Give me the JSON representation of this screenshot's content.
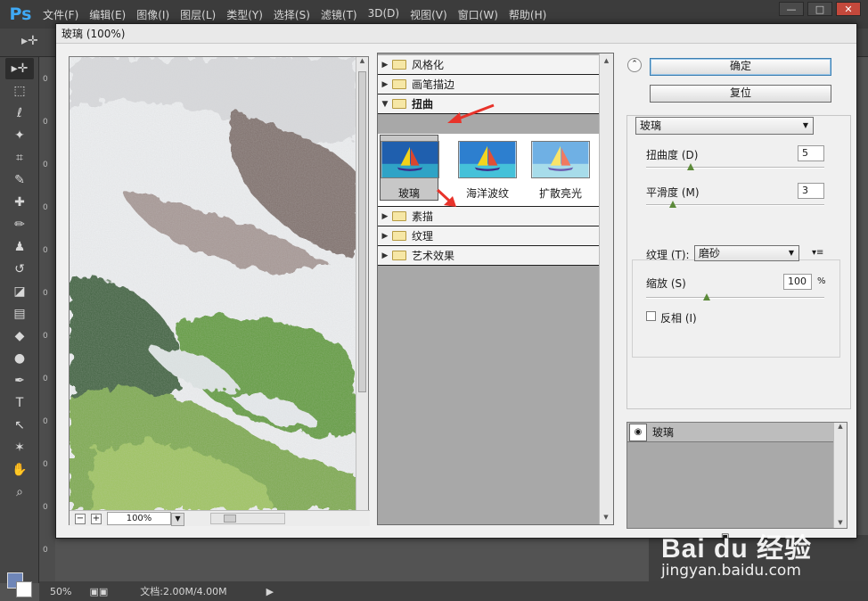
{
  "app": {
    "logo": "Ps",
    "menus": [
      "文件(F)",
      "编辑(E)",
      "图像(I)",
      "图层(L)",
      "类型(Y)",
      "选择(S)",
      "滤镜(T)",
      "3D(D)",
      "视图(V)",
      "窗口(W)",
      "帮助(H)"
    ],
    "window_controls": {
      "minimize": "—",
      "maximize": "□",
      "close": "✕"
    }
  },
  "toolbar": {
    "tools": [
      "move-icon",
      "marquee-icon",
      "lasso-icon",
      "magic-wand-icon",
      "crop-icon",
      "eyedropper-icon",
      "healing-icon",
      "brush-icon",
      "stamp-icon",
      "history-brush-icon",
      "eraser-icon",
      "gradient-icon",
      "blur-icon",
      "dodge-icon",
      "pen-icon",
      "type-icon",
      "path-select-icon",
      "shape-icon",
      "hand-icon",
      "zoom-icon"
    ],
    "glyphs": [
      "▸✛",
      "⬚",
      "ℓ",
      "✦",
      "⌗",
      "✎",
      "✚",
      "✏",
      "♟",
      "↺",
      "◪",
      "▤",
      "◆",
      "●",
      "✒",
      "T",
      "↖",
      "✶",
      "✋",
      "⌕"
    ],
    "ruler_numbers": [
      "0",
      "0",
      "0",
      "0",
      "0",
      "0",
      "0",
      "0",
      "0",
      "0",
      "0",
      "0"
    ]
  },
  "statusbar": {
    "zoom": "50%",
    "doc_info": "文档:2.00M/4.00M"
  },
  "watermark": {
    "logo": "Bai du 经验",
    "url": "jingyan.baidu.com"
  },
  "dialog": {
    "title": "玻璃 (100%)",
    "preview": {
      "zoom": "100%",
      "zoom_out": "−",
      "zoom_in": "+"
    },
    "gallery": {
      "folders_top": [
        {
          "label": "风格化",
          "expanded": false
        },
        {
          "label": "画笔描边",
          "expanded": false
        },
        {
          "label": "扭曲",
          "expanded": true
        }
      ],
      "thumbnails": [
        {
          "label": "玻璃",
          "selected": true
        },
        {
          "label": "海洋波纹",
          "selected": false
        },
        {
          "label": "扩散亮光",
          "selected": false
        }
      ],
      "folders_bottom": [
        {
          "label": "素描"
        },
        {
          "label": "纹理"
        },
        {
          "label": "艺术效果"
        }
      ]
    },
    "settings": {
      "ok_label": "确定",
      "reset_label": "复位",
      "filter_name": "玻璃",
      "distortion_label": "扭曲度 (D)",
      "distortion_value": "5",
      "distortion_level": 0.25,
      "smoothness_label": "平滑度 (M)",
      "smoothness_value": "3",
      "smoothness_level": 0.15,
      "texture_label": "纹理 (T):",
      "texture_value": "磨砂",
      "scale_label": "缩放 (S)",
      "scale_value": "100",
      "scale_unit": "%",
      "scale_level": 0.34,
      "invert_label": "反相 (I)",
      "invert_checked": false
    },
    "layers": {
      "effect_layer": "玻璃"
    }
  },
  "colors": {
    "accent_arrow": "#e8332a",
    "ps_logo": "#3fa9f5",
    "foreground_swatch": "#6f86b8"
  }
}
